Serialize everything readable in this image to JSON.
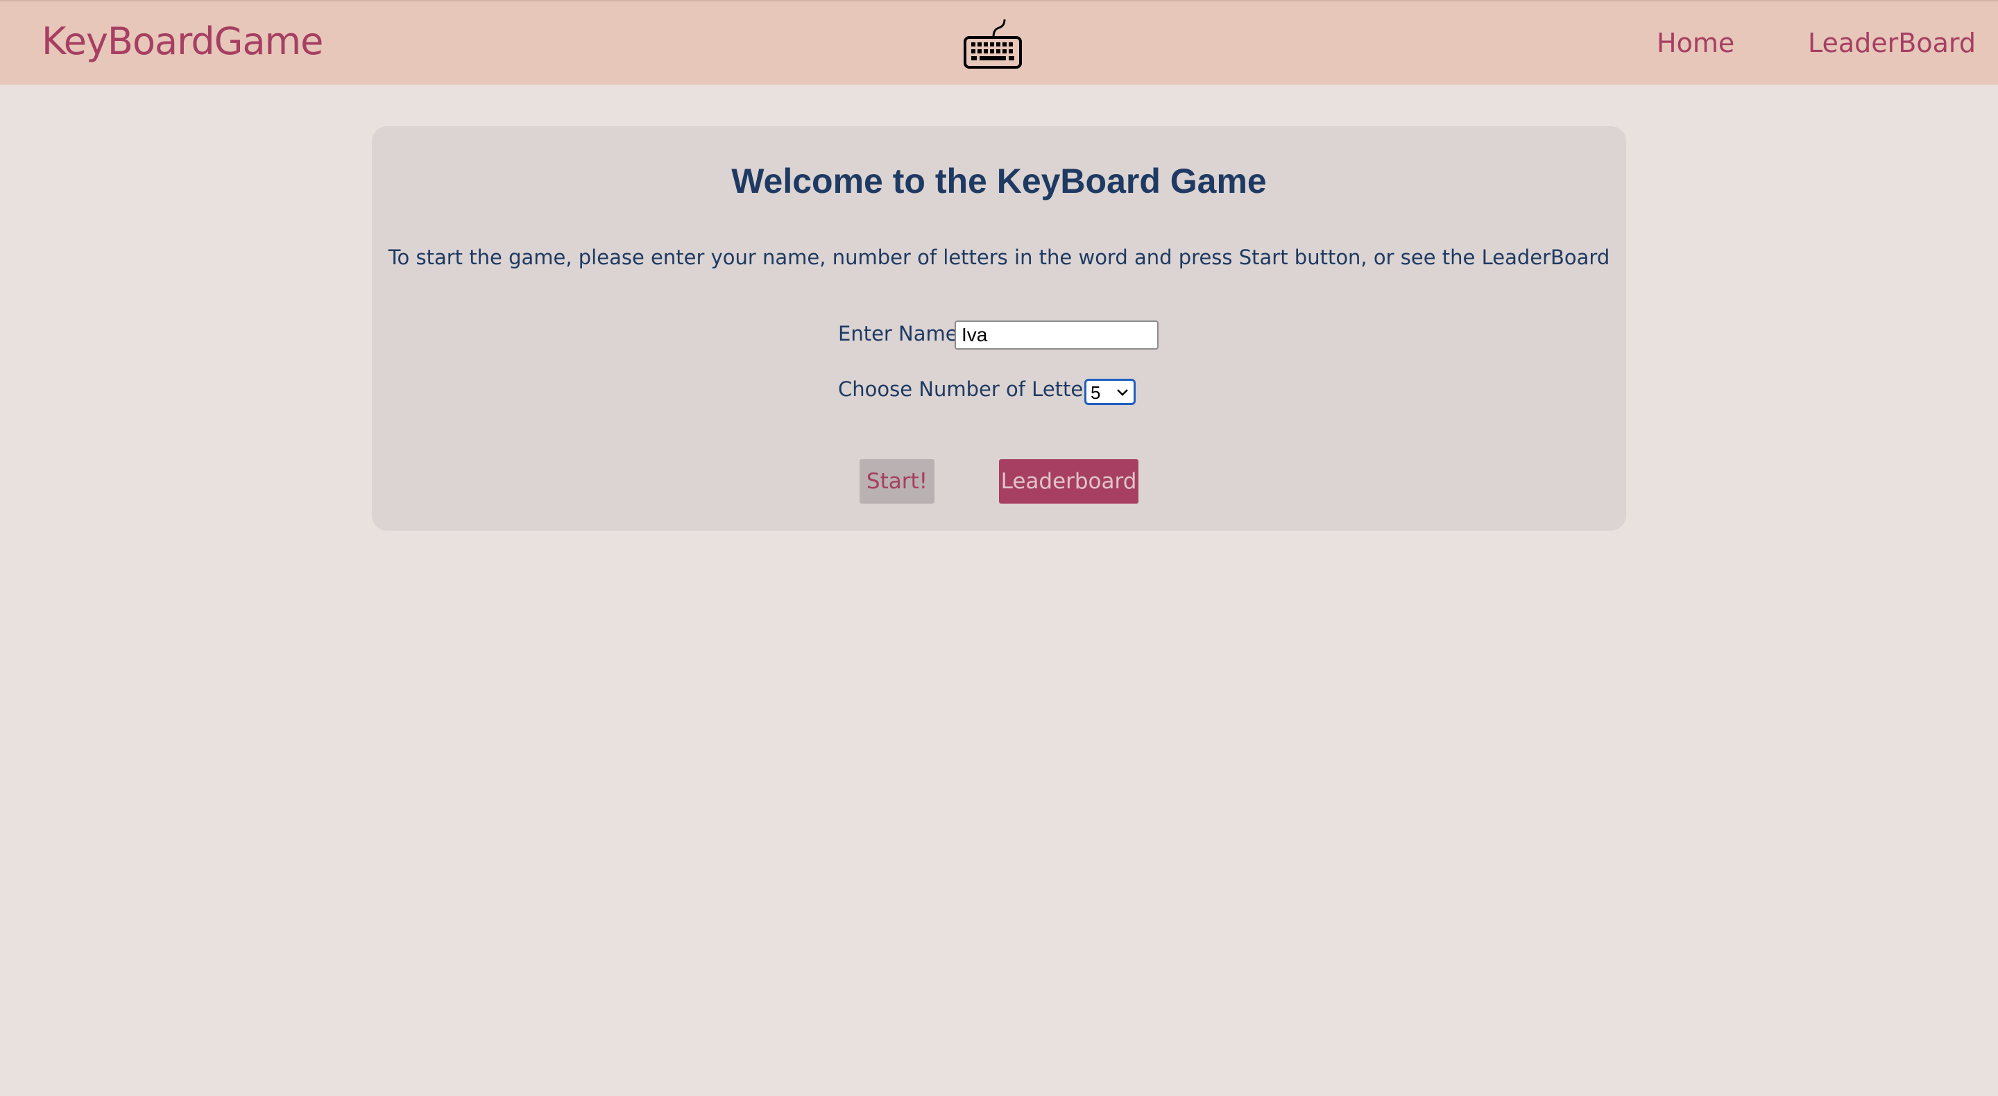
{
  "navbar": {
    "brand": "KeyBoardGame",
    "logo_icon": "keyboard-icon",
    "links": [
      {
        "label": "Home"
      },
      {
        "label": "LeaderBoard"
      }
    ]
  },
  "main": {
    "title": "Welcome to the KeyBoard Game",
    "intro": "To start the game, please enter your name, number of letters in the word and press Start button, or see the LeaderBoard",
    "name_label": "Enter Name:",
    "name_value": "Iva",
    "letters_label": "Choose Number of Letters:",
    "letters_selected": "5",
    "start_label": "Start!",
    "leaderboard_label": "Leaderboard"
  },
  "colors": {
    "page_background": "#e9e1dd",
    "navbar_background": "#e6c7ba",
    "card_background": "#dcd4d2",
    "accent": "#a63f62",
    "text_primary": "#1e3a63"
  }
}
